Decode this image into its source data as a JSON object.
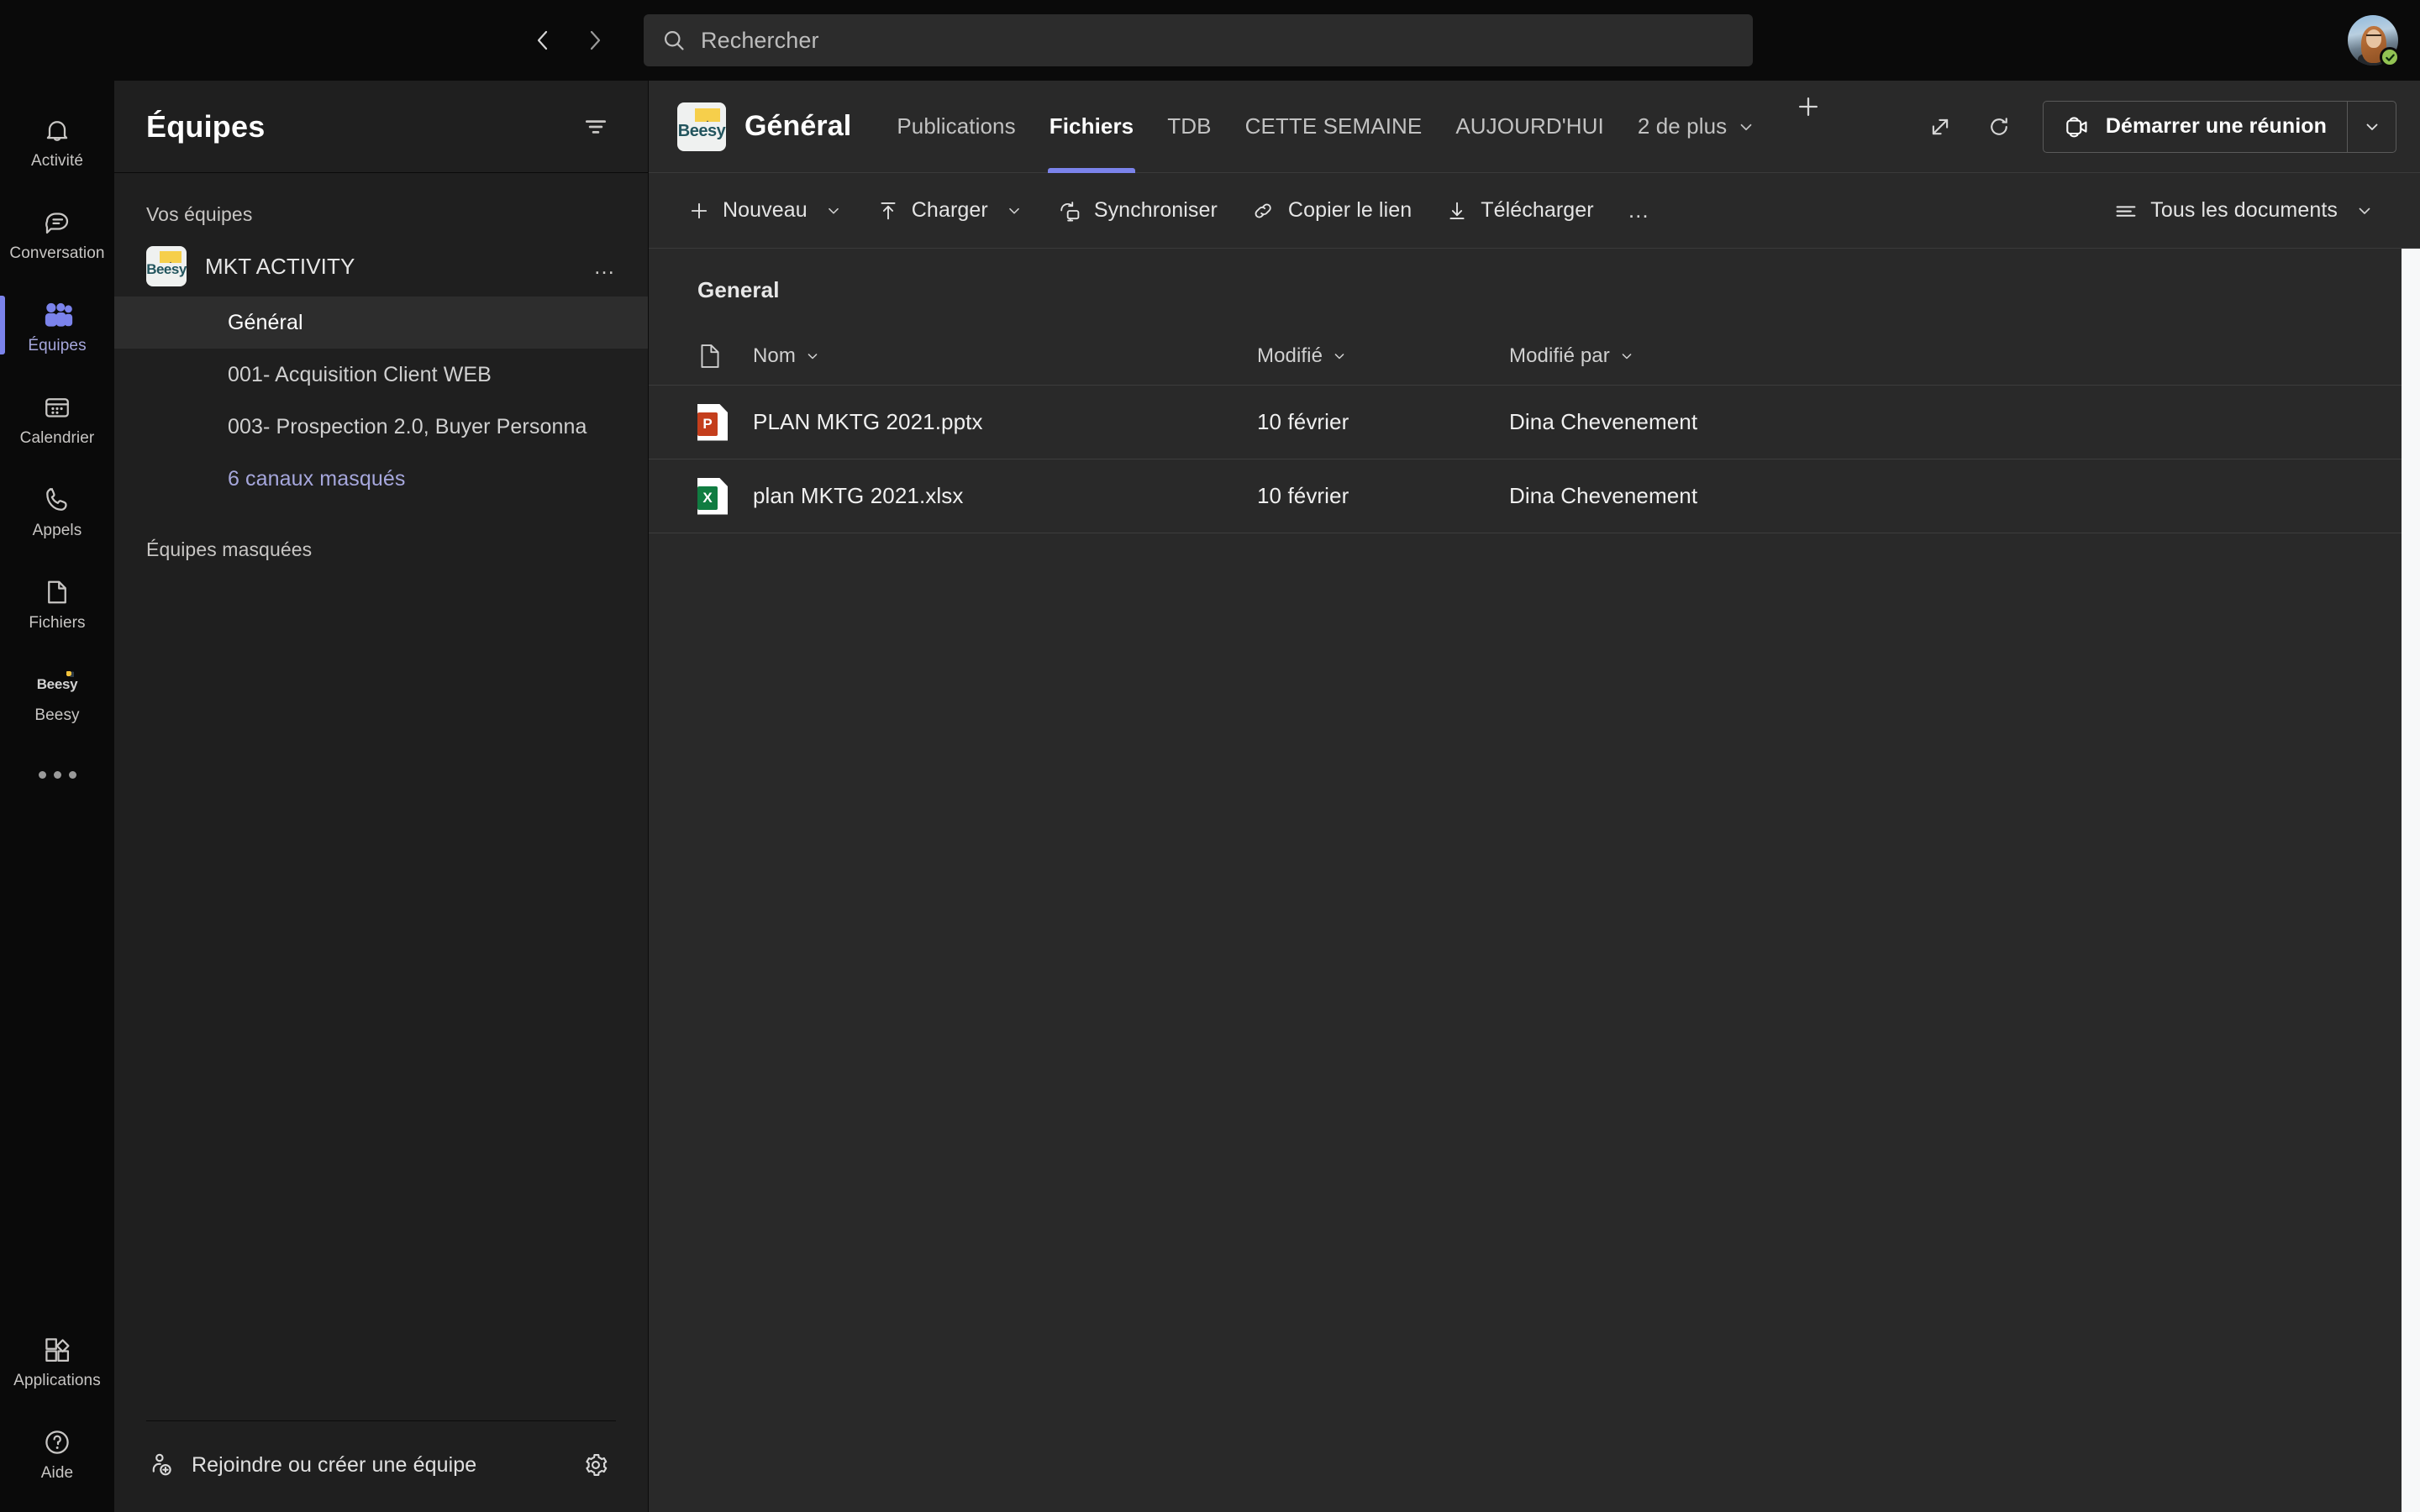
{
  "topbar": {
    "back_label": "Précédent",
    "forward_label": "Suivant",
    "search_placeholder": "Rechercher",
    "search_value": "",
    "presence_status": "Disponible"
  },
  "rail": {
    "items": [
      {
        "label": "Activité",
        "icon": "bell-icon",
        "active": false
      },
      {
        "label": "Conversation",
        "icon": "chat-icon",
        "active": false
      },
      {
        "label": "Équipes",
        "icon": "teams-icon",
        "active": true
      },
      {
        "label": "Calendrier",
        "icon": "calendar-icon",
        "active": false
      },
      {
        "label": "Appels",
        "icon": "phone-icon",
        "active": false
      },
      {
        "label": "Fichiers",
        "icon": "file-icon",
        "active": false
      },
      {
        "label": "Beesy",
        "icon": "beesy-app-icon",
        "active": false
      }
    ],
    "more_label": "…",
    "bottom_items": [
      {
        "label": "Applications",
        "icon": "apps-icon"
      },
      {
        "label": "Aide",
        "icon": "help-icon"
      }
    ]
  },
  "teams_panel": {
    "title": "Équipes",
    "filter_label": "Filtrer",
    "groups": [
      {
        "label": "Vos équipes"
      },
      {
        "label": "Équipes masquées"
      }
    ],
    "team": {
      "name": "MKT ACTIVITY",
      "avatar_text": "Beesy",
      "more_label": "…"
    },
    "channels": [
      {
        "label": "Général",
        "selected": true,
        "link": false
      },
      {
        "label": "001- Acquisition Client WEB",
        "selected": false,
        "link": false
      },
      {
        "label": "003- Prospection 2.0, Buyer Personna",
        "selected": false,
        "link": false
      },
      {
        "label": "6 canaux masqués",
        "selected": false,
        "link": true
      }
    ],
    "footer": {
      "join_label": "Rejoindre ou créer une équipe",
      "settings_label": "Paramètres"
    }
  },
  "channel_header": {
    "avatar_text": "Beesy",
    "title": "Général",
    "tabs": [
      {
        "label": "Publications",
        "active": false,
        "has_chevron": false
      },
      {
        "label": "Fichiers",
        "active": true,
        "has_chevron": false
      },
      {
        "label": "TDB",
        "active": false,
        "has_chevron": false
      },
      {
        "label": "CETTE SEMAINE",
        "active": false,
        "has_chevron": false
      },
      {
        "label": "AUJOURD'HUI",
        "active": false,
        "has_chevron": false
      },
      {
        "label": "2 de plus",
        "active": false,
        "has_chevron": true
      }
    ],
    "add_tab_label": "+",
    "open_in_new_label": "Ouvrir dans une nouvelle fenêtre",
    "refresh_label": "Actualiser",
    "meeting_button": "Démarrer une réunion",
    "meeting_dropdown_label": "Options de réunion"
  },
  "files_toolbar": {
    "buttons": [
      {
        "label": "Nouveau",
        "icon": "plus-icon",
        "has_chevron": true
      },
      {
        "label": "Charger",
        "icon": "upload-icon",
        "has_chevron": true
      },
      {
        "label": "Synchroniser",
        "icon": "sync-icon",
        "has_chevron": false
      },
      {
        "label": "Copier le lien",
        "icon": "link-icon",
        "has_chevron": false
      },
      {
        "label": "Télécharger",
        "icon": "download-icon",
        "has_chevron": false
      }
    ],
    "overflow_label": "…",
    "view_label": "Tous les documents"
  },
  "files": {
    "breadcrumb": "General",
    "columns": [
      {
        "label": "Nom",
        "sortable": true
      },
      {
        "label": "Modifié",
        "sortable": true
      },
      {
        "label": "Modifié par",
        "sortable": true
      }
    ],
    "rows": [
      {
        "name": "PLAN MKTG 2021.pptx",
        "modified": "10 février",
        "modified_by": "Dina Chevenement",
        "icon": "powerpoint-icon",
        "icon_letter": "P"
      },
      {
        "name": "plan MKTG 2021.xlsx",
        "modified": "10 février",
        "modified_by": "Dina Chevenement",
        "icon": "excel-icon",
        "icon_letter": "X"
      }
    ]
  },
  "colors": {
    "accent": "#7b83eb",
    "accent_text": "#a6a7dc",
    "presence_available": "#92c353",
    "powerpoint": "#c43e1c",
    "excel": "#107c41",
    "rail_bg": "#0a0a0a",
    "panel_bg": "#1f1f1f",
    "main_bg": "#292929"
  }
}
